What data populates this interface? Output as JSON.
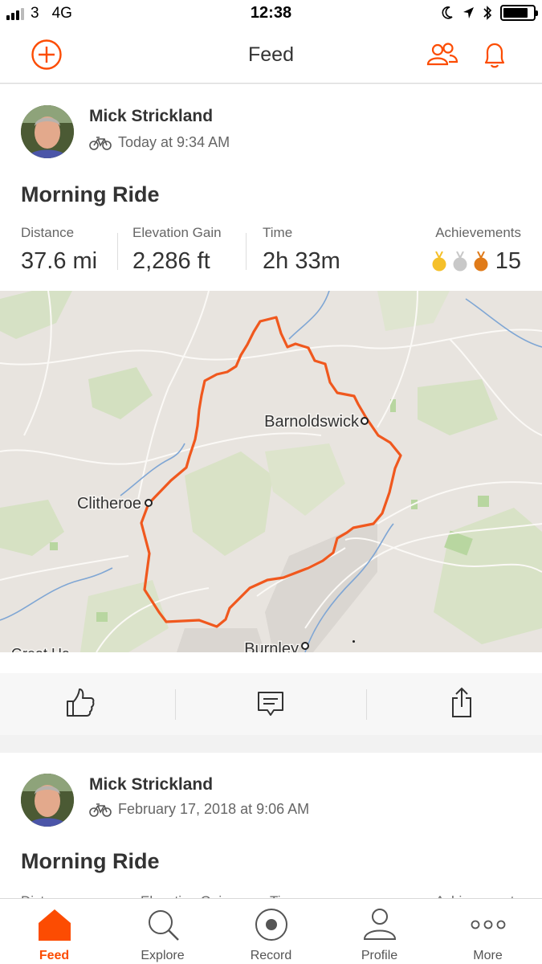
{
  "status_bar": {
    "carrier": "3",
    "network": "4G",
    "time": "12:38"
  },
  "header": {
    "title": "Feed",
    "icons": [
      "add-circle-icon",
      "find-friends-icon",
      "notifications-bell-icon"
    ]
  },
  "colors": {
    "accent": "#fc4c02",
    "route": "#f0581e",
    "gold": "#f5c02a",
    "silver": "#c8c8c8",
    "bronze": "#e07b1a"
  },
  "activities": [
    {
      "athlete": "Mick Strickland",
      "activity_type_icon": "bike-icon",
      "timestamp": "Today at 9:34 AM",
      "title": "Morning Ride",
      "stats": {
        "distance_label": "Distance",
        "distance_value": "37.6 mi",
        "elevation_label": "Elevation Gain",
        "elevation_value": "2,286 ft",
        "time_label": "Time",
        "time_value": "2h 33m",
        "achievements_label": "Achievements",
        "achievements_count": "15"
      },
      "map_labels": {
        "town1": "Barnoldswick",
        "town2": "Clitheroe",
        "town3": "Burnley",
        "town4": "Great Ha"
      },
      "actions": [
        "thumbs-up-icon",
        "comment-icon",
        "share-icon"
      ]
    },
    {
      "athlete": "Mick Strickland",
      "activity_type_icon": "bike-icon",
      "timestamp": "February 17, 2018 at 9:06 AM",
      "title": "Morning Ride",
      "stats": {
        "distance_label": "Distance",
        "elevation_label": "Elevation Gain",
        "time_label": "Time",
        "achievements_label": "Achievements"
      }
    }
  ],
  "tabs": [
    {
      "label": "Feed",
      "icon": "home-icon",
      "active": true
    },
    {
      "label": "Explore",
      "icon": "search-icon"
    },
    {
      "label": "Record",
      "icon": "record-icon"
    },
    {
      "label": "Profile",
      "icon": "person-icon"
    },
    {
      "label": "More",
      "icon": "more-icon"
    }
  ]
}
